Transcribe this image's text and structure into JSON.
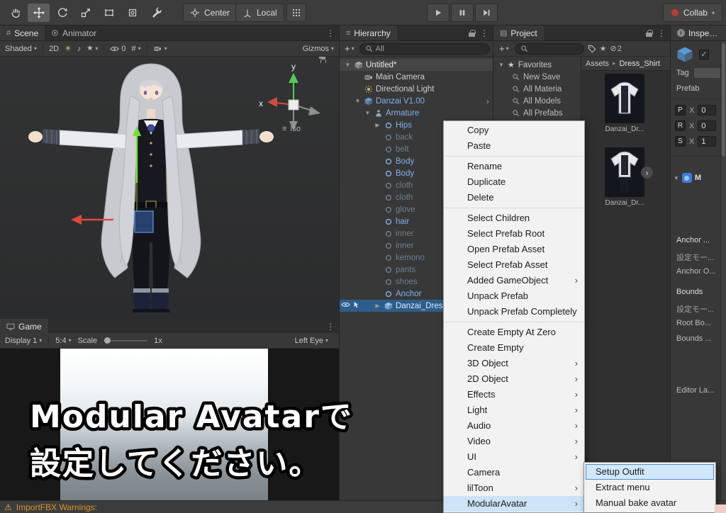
{
  "icons": {
    "caret": "▾",
    "menu_dots": "⋮",
    "chevron": "›",
    "breadcrumb_sep": "▸",
    "plus": "+",
    "star": "★",
    "hidden": "⊘",
    "warning": "⚠",
    "check": "✓",
    "iso_prefix": "≡",
    "scene_tab": "#",
    "hierarchy_tab": "≡",
    "project_tab": "▤",
    "info": "i",
    "bulb": "☀",
    "audio": "♪",
    "effects": "★",
    "grid": "#",
    "expand_open": "▼",
    "expand_closed": "▶"
  },
  "topbar": {
    "pivot": "Center",
    "space": "Local",
    "collab": "Collab"
  },
  "scene_panel": {
    "tab_scene": "Scene",
    "tab_animator": "Animator",
    "shading": "Shaded",
    "mode_2d": "2D",
    "hidden_count": "0",
    "gizmos": "Gizmos",
    "axis": {
      "x": "x",
      "y": "y",
      "projection": "Iso"
    }
  },
  "game_panel": {
    "tab": "Game",
    "display": "Display 1",
    "aspect": "5:4",
    "scale_label": "Scale",
    "scale_value": "1x",
    "eye_mode": "Left Eye",
    "overlay_line1": "Modular Avatarで",
    "overlay_line2": "設定してください。"
  },
  "status_bar": {
    "message": "ImportFBX Warnings:"
  },
  "hierarchy": {
    "title": "Hierarchy",
    "search_filter": "All",
    "items": [
      {
        "label": "Untitled*",
        "type": "scene"
      },
      {
        "label": "Main Camera",
        "type": "camera"
      },
      {
        "label": "Directional Light",
        "type": "light"
      },
      {
        "label": "Danzai V1.00",
        "type": "prefab-root"
      },
      {
        "label": "Armature",
        "type": "prefab-child"
      },
      {
        "label": "Hips",
        "type": "prefab-child"
      },
      {
        "label": "back",
        "state": "inactive"
      },
      {
        "label": "belt",
        "state": "inactive"
      },
      {
        "label": "Body",
        "state": "active"
      },
      {
        "label": "Body",
        "state": "active"
      },
      {
        "label": "cloth",
        "state": "inactive"
      },
      {
        "label": "cloth",
        "state": "inactive"
      },
      {
        "label": "glove",
        "state": "inactive"
      },
      {
        "label": "hair",
        "state": "active"
      },
      {
        "label": "inner",
        "state": "inactive"
      },
      {
        "label": "inner",
        "state": "inactive"
      },
      {
        "label": "kemono",
        "state": "inactive"
      },
      {
        "label": "pants",
        "state": "inactive"
      },
      {
        "label": "shoes",
        "state": "inactive"
      },
      {
        "label": "Anchor",
        "state": "active"
      },
      {
        "label": "Danzai_Dress",
        "state": "selected"
      }
    ]
  },
  "context_menu": {
    "items": [
      "Copy",
      "Paste",
      "Rename",
      "Duplicate",
      "Delete",
      "Select Children",
      "Select Prefab Root",
      "Open Prefab Asset",
      "Select Prefab Asset",
      "Added GameObject",
      "Unpack Prefab",
      "Unpack Prefab Completely",
      "Create Empty At Zero",
      "Create Empty",
      "3D Object",
      "2D Object",
      "Effects",
      "Light",
      "Audio",
      "Video",
      "UI",
      "Camera",
      "lilToon",
      "ModularAvatar"
    ]
  },
  "submenu": {
    "items": [
      "Setup Outfit",
      "Extract menu",
      "Manual bake avatar"
    ]
  },
  "project": {
    "title": "Project",
    "favorites_header": "Favorites",
    "favorites": [
      "New Save",
      "All Materia",
      "All Models",
      "All Prefabs"
    ],
    "breadcrumb_root": "Assets",
    "breadcrumb_current": "Dress_Shirt",
    "assets": [
      {
        "label": "Danzai_Dr..."
      },
      {
        "label": "Danzai_Dr..."
      }
    ],
    "hidden_badge": "2"
  },
  "inspector": {
    "title": "Inspector",
    "tag_label": "Tag",
    "prefab_label": "Prefab",
    "transform_rows": [
      {
        "key": "P",
        "axis": "X",
        "value": "0"
      },
      {
        "key": "R",
        "axis": "X",
        "value": "0"
      },
      {
        "key": "S",
        "axis": "X",
        "value": "1"
      }
    ],
    "component_label": "M",
    "fields": [
      {
        "label": "Anchor ..."
      },
      {
        "label": "設定モー..."
      },
      {
        "label": "Anchor O..."
      },
      {
        "label": "Bounds"
      },
      {
        "label": "設定モー..."
      },
      {
        "label": "Root Bo..."
      },
      {
        "label": "Bounds ..."
      },
      {
        "label": "Editor La..."
      }
    ]
  }
}
